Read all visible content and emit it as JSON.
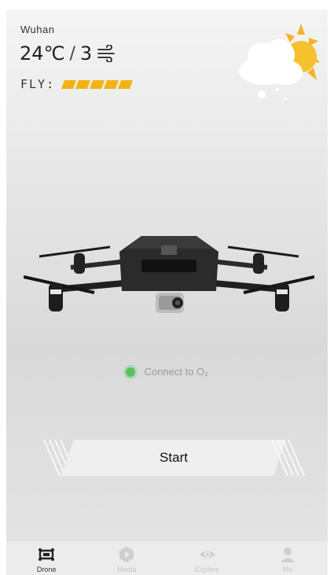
{
  "weather": {
    "city": "Wuhan",
    "temperature": "24℃",
    "separator": "/",
    "wind_level": "3",
    "wind_icon": "wind-icon",
    "fly_label": "FLY:",
    "fly_rating": 5,
    "fly_rating_max": 5,
    "condition_icon": "partly-sunny-icon"
  },
  "colors": {
    "accent": "#f2b316",
    "connect_dot": "#55c35a"
  },
  "connection": {
    "status_label": "Connect to O₂"
  },
  "start_button": {
    "label": "Start"
  },
  "tabs": [
    {
      "label": "Drone",
      "icon": "drone-icon",
      "active": true
    },
    {
      "label": "Media",
      "icon": "media-icon",
      "active": false
    },
    {
      "label": "Explore",
      "icon": "eye-icon",
      "active": false
    },
    {
      "label": "Me",
      "icon": "user-icon",
      "active": false
    }
  ]
}
